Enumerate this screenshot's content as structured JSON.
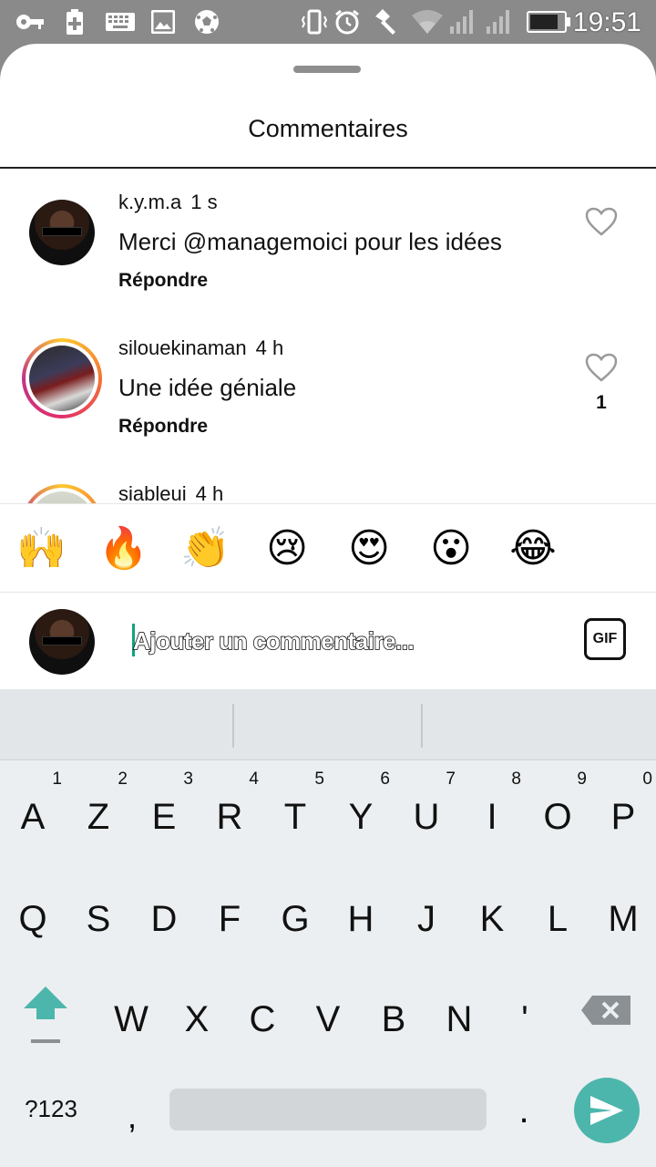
{
  "status_bar": {
    "time": "19:51",
    "icons": [
      "key-icon",
      "battery-saver-icon",
      "keyboard-icon",
      "image-icon",
      "soccer-ball-icon",
      "vibrate-icon",
      "alarm-icon",
      "flashlight-icon",
      "wifi-icon",
      "signal-icon",
      "signal-icon-2",
      "battery-icon"
    ]
  },
  "sheet": {
    "title": "Commentaires"
  },
  "comments": [
    {
      "username": "k.y.m.a",
      "time": "1 s",
      "text": "Merci @managemoici pour les idées",
      "reply_label": "Répondre",
      "likes": ""
    },
    {
      "username": "silouekinaman",
      "time": "4 h",
      "text": "Une idée géniale",
      "reply_label": "Répondre",
      "likes": "1"
    },
    {
      "username": "siableui",
      "time": "4 h",
      "text": "",
      "reply_label": "",
      "likes": ""
    }
  ],
  "emoji_bar": [
    "🙌",
    "🔥",
    "👏",
    "😢",
    "😍",
    "😮",
    "😂"
  ],
  "input": {
    "placeholder": "Ajouter un commentaire...",
    "gif_label": "GIF"
  },
  "keyboard": {
    "row1": [
      {
        "key": "A",
        "hint": "1"
      },
      {
        "key": "Z",
        "hint": "2"
      },
      {
        "key": "E",
        "hint": "3"
      },
      {
        "key": "R",
        "hint": "4"
      },
      {
        "key": "T",
        "hint": "5"
      },
      {
        "key": "Y",
        "hint": "6"
      },
      {
        "key": "U",
        "hint": "7"
      },
      {
        "key": "I",
        "hint": "8"
      },
      {
        "key": "O",
        "hint": "9"
      },
      {
        "key": "P",
        "hint": "0"
      }
    ],
    "row2": [
      "Q",
      "S",
      "D",
      "F",
      "G",
      "H",
      "J",
      "K",
      "L",
      "M"
    ],
    "row3": [
      "W",
      "X",
      "C",
      "V",
      "B",
      "N",
      "'"
    ],
    "symbols_label": "?123",
    "comma_label": ",",
    "period_label": ".",
    "colors": {
      "send_button": "#4db6ac",
      "shift_arrow": "#4db6ac"
    }
  }
}
